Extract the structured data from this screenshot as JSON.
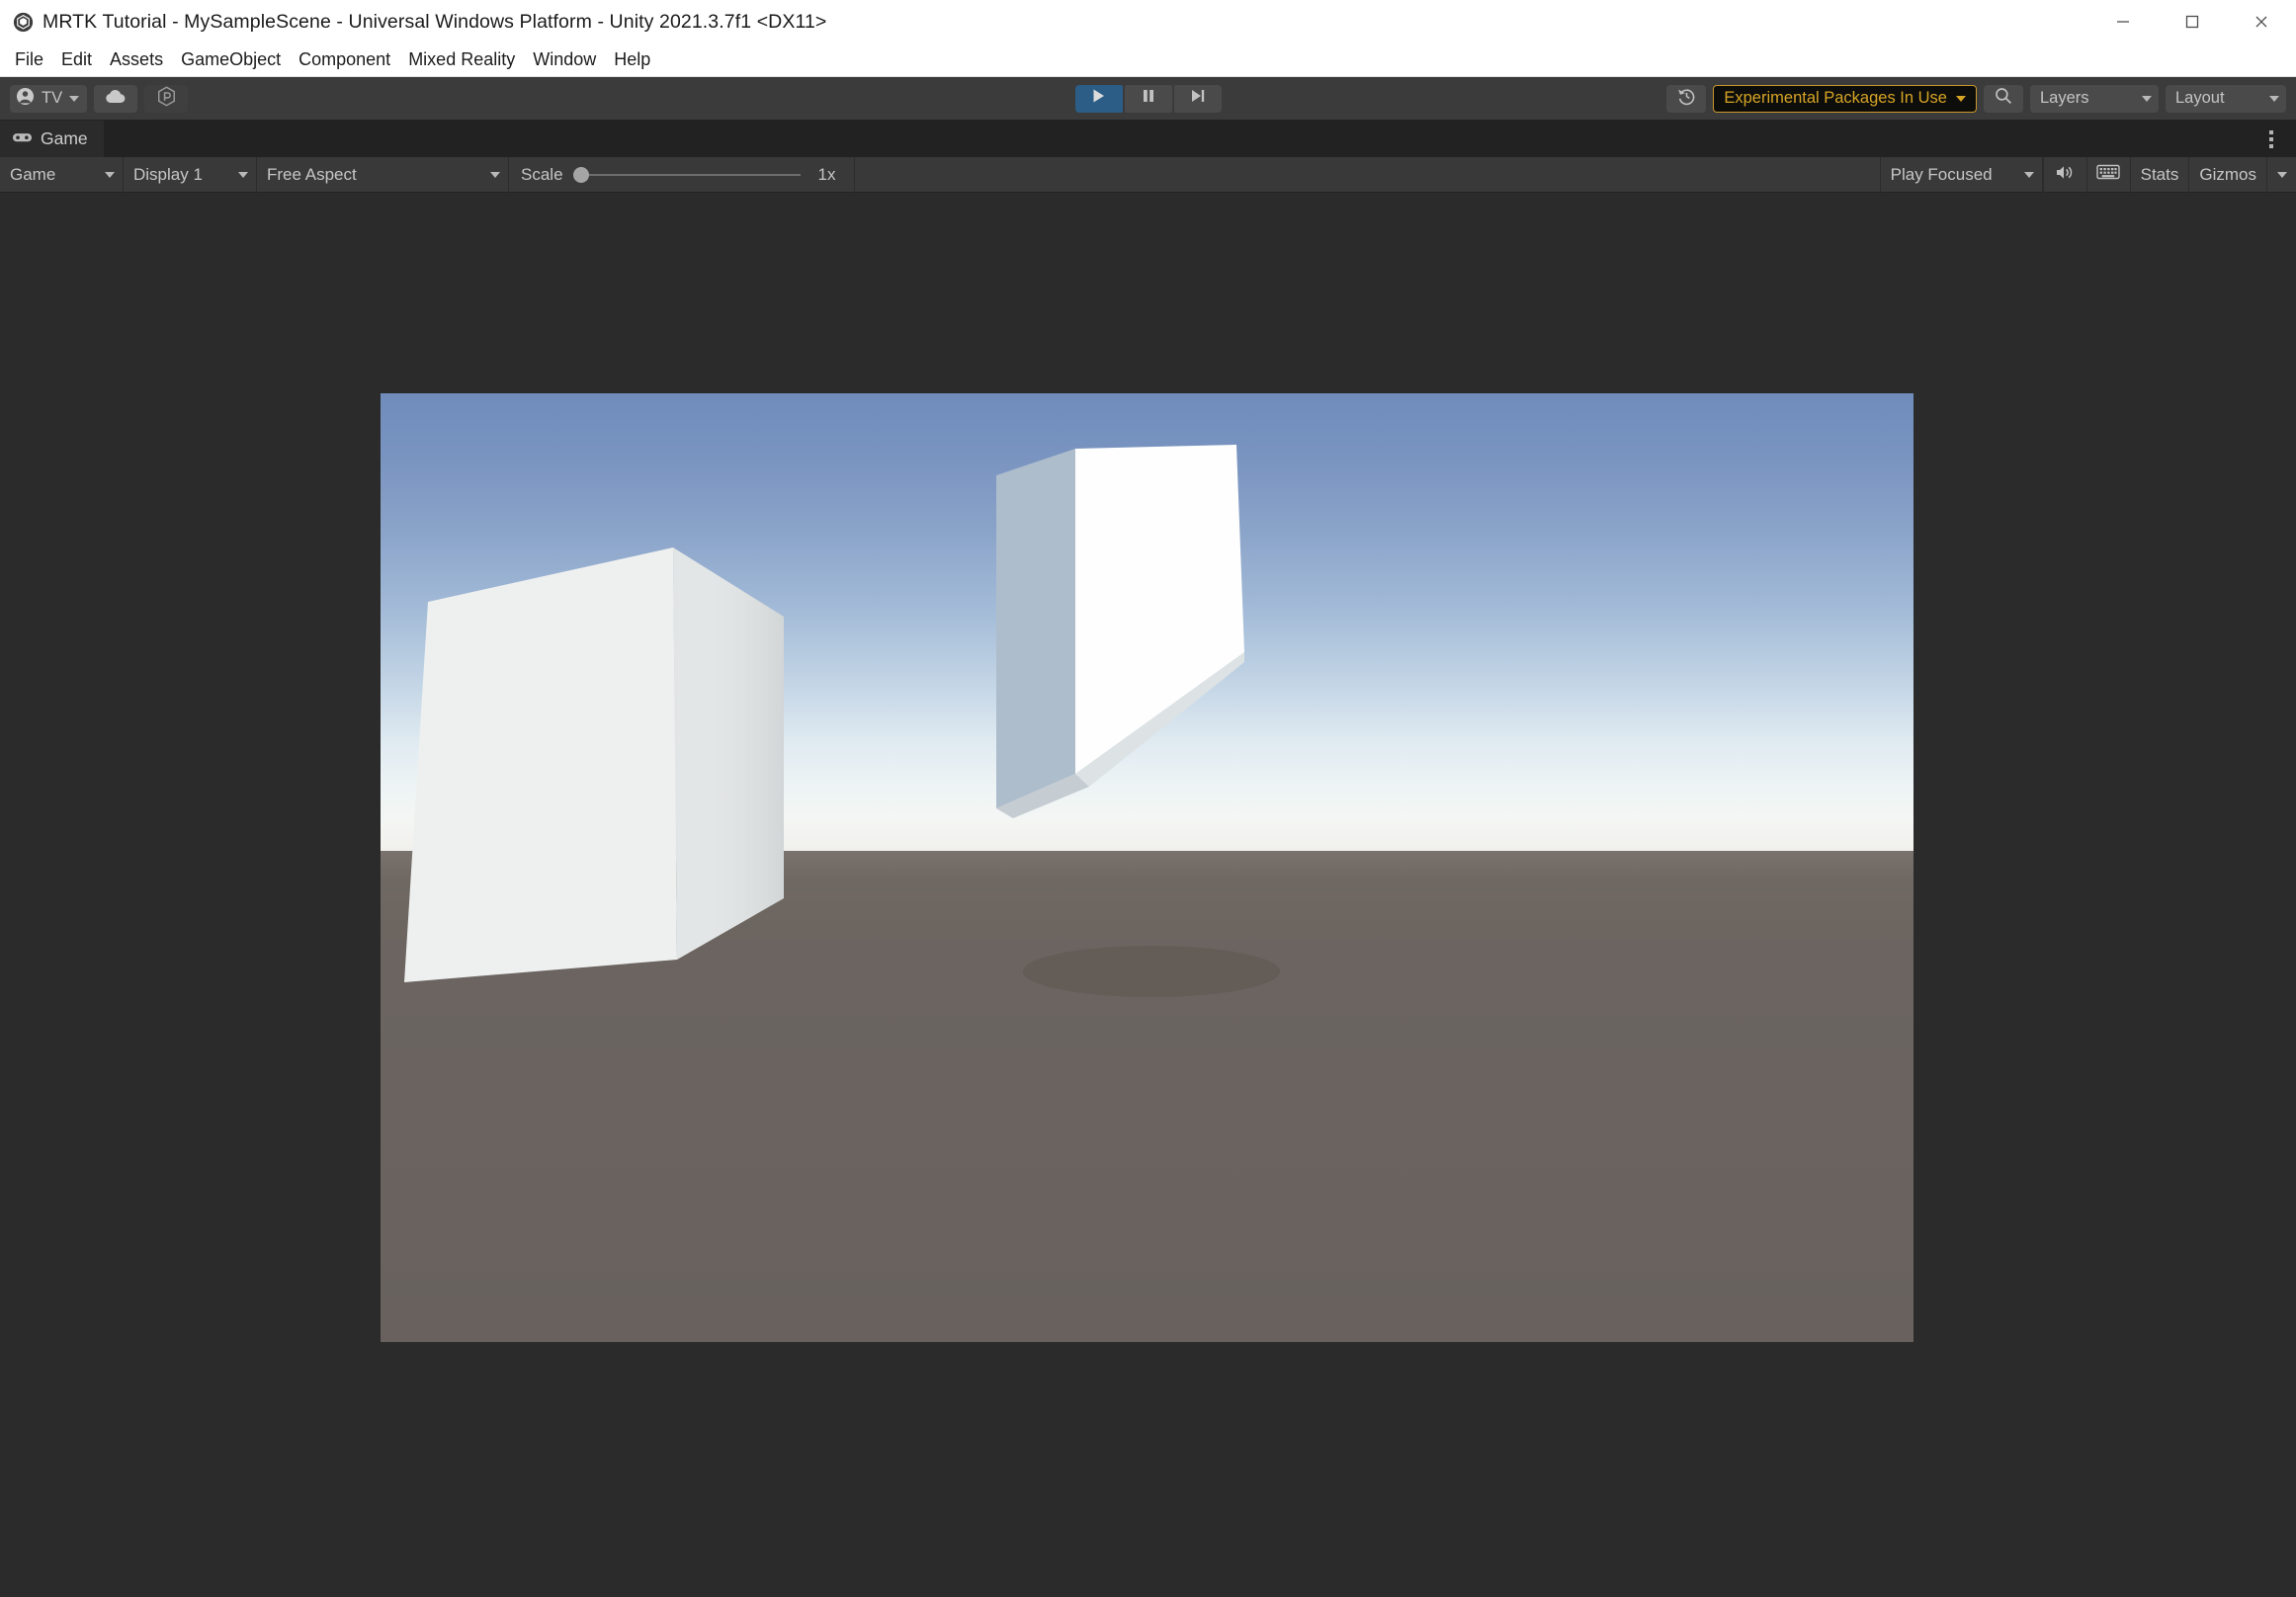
{
  "window": {
    "title": "MRTK Tutorial - MySampleScene - Universal Windows Platform - Unity 2021.3.7f1 <DX11>",
    "logo_icon": "unity-logo-icon",
    "controls": {
      "minimize": "minimize-icon",
      "maximize": "maximize-icon",
      "close": "close-icon"
    }
  },
  "menubar": {
    "items": [
      {
        "label": "File"
      },
      {
        "label": "Edit"
      },
      {
        "label": "Assets"
      },
      {
        "label": "GameObject"
      },
      {
        "label": "Component"
      },
      {
        "label": "Mixed Reality"
      },
      {
        "label": "Window"
      },
      {
        "label": "Help"
      }
    ]
  },
  "toolbar": {
    "account": {
      "label": "TV",
      "icon": "account-person-icon"
    },
    "cloud": {
      "icon": "cloud-icon"
    },
    "services": {
      "icon": "unity-services-icon"
    },
    "play_controls": {
      "play": {
        "icon": "play-icon",
        "state": "active"
      },
      "pause": {
        "icon": "pause-icon",
        "state": "inactive"
      },
      "step": {
        "icon": "step-forward-icon",
        "state": "inactive"
      }
    },
    "undo_history": {
      "icon": "undo-history-icon"
    },
    "experimental": {
      "label": "Experimental Packages In Use",
      "text_color": "#d6a426",
      "border_color": "#c9972a",
      "background_color": "#0d0d0b"
    },
    "search": {
      "icon": "search-icon"
    },
    "layers": {
      "label": "Layers"
    },
    "layout": {
      "label": "Layout"
    }
  },
  "panel": {
    "tab": {
      "label": "Game",
      "icon": "gamepad-icon"
    },
    "menu": {
      "icon": "kebab-menu-icon"
    },
    "toolbar": {
      "view_mode": "Game",
      "display": "Display 1",
      "aspect": "Free Aspect",
      "scale_label": "Scale",
      "scale_value": "1x",
      "scale_position_percent": 0,
      "play_focus": "Play Focused",
      "mute_audio": {
        "icon": "speaker-icon"
      },
      "frame_debug": {
        "icon": "keyboard-grid-icon"
      },
      "stats": "Stats",
      "gizmos": "Gizmos"
    }
  },
  "scene": {
    "description": "Unity Game view in play mode showing two white cubes on a gray-brown ground plane under a blue gradient sky",
    "colors": {
      "sky_top": "#6f8cbb",
      "sky_horizon": "#f2f5f3",
      "ground": "#6b6460",
      "cube_front": "#eef0f0",
      "cube_side": "#e0e3e3",
      "cube_top_bright": "#fefefe",
      "cube_shadow_side": "#aebdcc",
      "viewport_background": "#2b2b2b"
    },
    "objects": [
      {
        "name": "large-cube",
        "position": "left-foreground",
        "front_face_color": "#eef0f0",
        "right_face_color": "#e0e3e3"
      },
      {
        "name": "small-cube",
        "position": "right-midground",
        "top_face_color": "#fefefe",
        "left_face_color": "#aebdcc",
        "bottom_face_color": "#d6dbde"
      }
    ]
  }
}
